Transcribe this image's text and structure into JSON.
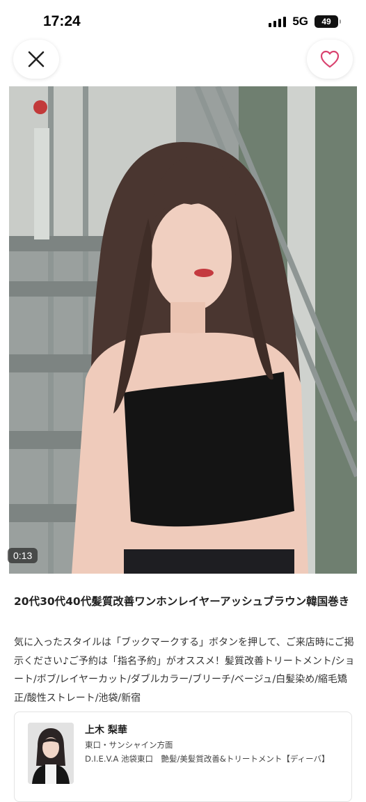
{
  "status_bar": {
    "time": "17:24",
    "network": "5G",
    "battery": "49"
  },
  "icons": {
    "close": "close-icon",
    "favorite": "heart-icon",
    "favorite_color": "#d9436f"
  },
  "media": {
    "duration": "0:13"
  },
  "style": {
    "title": "20代30代40代髪質改善ワンホンレイヤーアッシュブラウン韓国巻き",
    "description": "気に入ったスタイルは「ブックマークする」ボタンを押して、ご来店時にご掲示ください♪ご予約は「指名予約」がオススメ！髪質改善トリートメント/ショート/ボブ/レイヤーカット/ダブルカラー/ブリーチ/ベージュ/白髪染め/縮毛矯正/酸性ストレート/池袋/新宿"
  },
  "stylist": {
    "name": "上木 梨華",
    "area": "東口・サンシャイン方面",
    "salon": "D.I.E.V.A 池袋東口　艶髪/美髪質改善&トリートメント【ディーバ】"
  }
}
